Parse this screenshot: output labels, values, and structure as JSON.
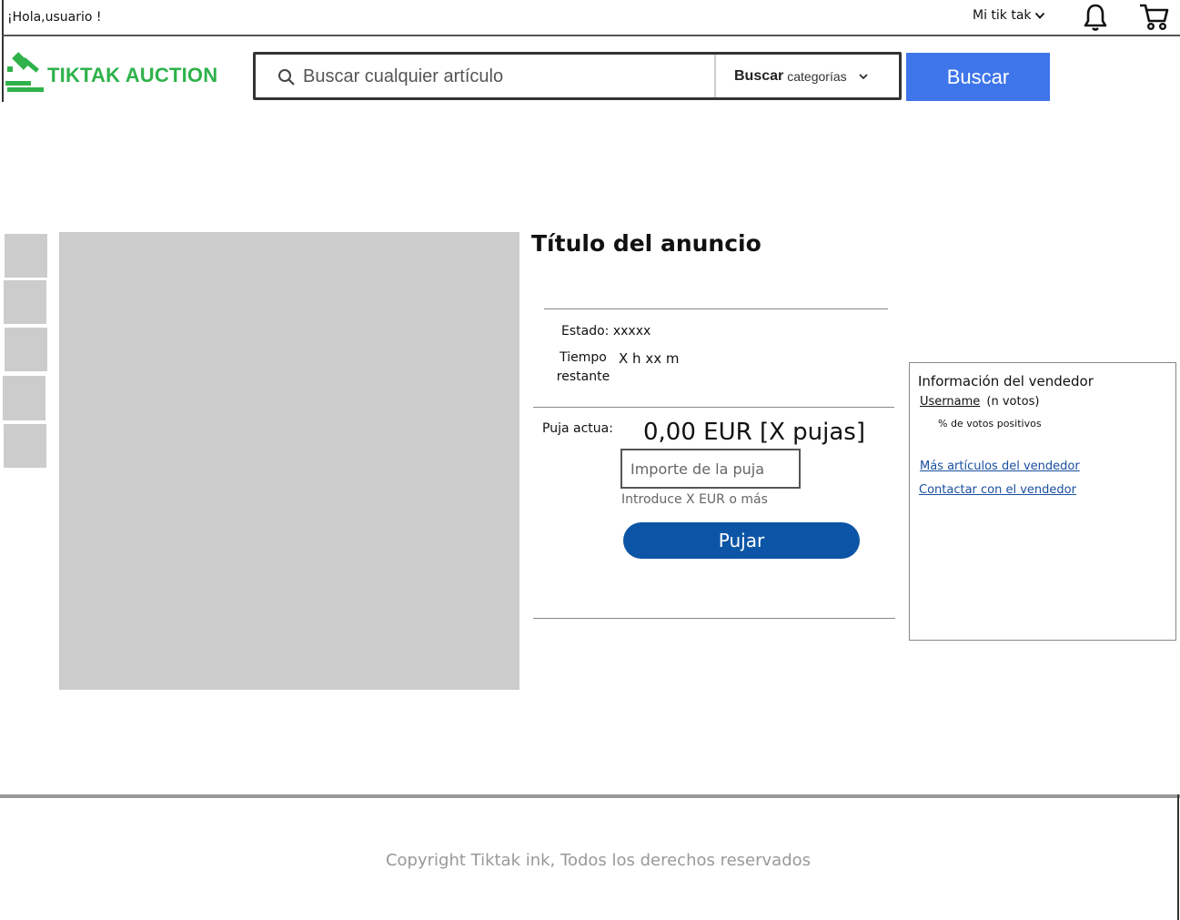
{
  "topbar": {
    "greeting": "¡Hola,usuario !",
    "account_menu_label": "Mi tik tak"
  },
  "header": {
    "logo_text": "TIKTAK AUCTION",
    "search_placeholder": "Buscar cualquier artículo",
    "category_bold": "Buscar",
    "category_rest": "categorías",
    "search_button": "Buscar"
  },
  "gallery": {
    "thumbnail_count": 5
  },
  "listing": {
    "title": "Título del anuncio",
    "estado_label": "Estado:",
    "estado_value": "xxxxx",
    "tiempo_label": "Tiempo restante",
    "tiempo_value": "X h xx m",
    "puja_label": "Puja actua:",
    "current_price": "0,00 EUR [X pujas]",
    "bid_placeholder": "Importe de la puja",
    "bid_hint": "Introduce X EUR o más",
    "bid_button": "Pujar"
  },
  "seller": {
    "title": "Información del vendedor",
    "username": "Username",
    "votes": "(n votos)",
    "positive_pct": "% de votos positivos",
    "more_items_link": "Más artículos del vendedor",
    "contact_link": "Contactar con el vendedor"
  },
  "footer": {
    "copyright": "Copyright Tiktak ink, Todos los derechos reservados"
  },
  "colors": {
    "brand_green": "#2fb24a",
    "search_button_blue": "#3f75ea",
    "bid_button_blue": "#0c55a6",
    "link_blue": "#1a4fa0",
    "placeholder_gray": "#cccccc"
  },
  "icons": [
    "chevron-down-icon",
    "bell-icon",
    "cart-icon",
    "gavel-logo-icon",
    "search-icon"
  ]
}
